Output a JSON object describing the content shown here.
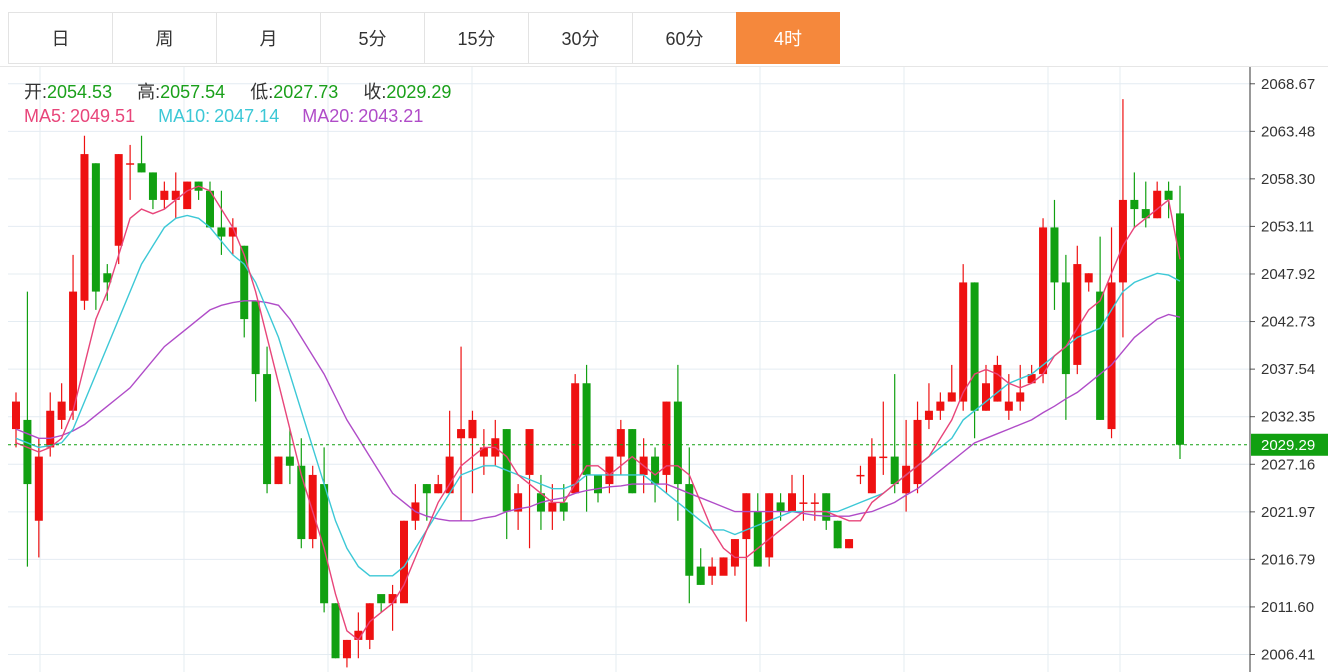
{
  "tabs": [
    {
      "label": "日",
      "active": false
    },
    {
      "label": "周",
      "active": false
    },
    {
      "label": "月",
      "active": false
    },
    {
      "label": "5分",
      "active": false
    },
    {
      "label": "15分",
      "active": false
    },
    {
      "label": "30分",
      "active": false
    },
    {
      "label": "60分",
      "active": false
    },
    {
      "label": "4时",
      "active": true
    }
  ],
  "info": {
    "open_label": "开:",
    "open": "2054.53",
    "high_label": "高:",
    "high": "2057.54",
    "low_label": "低:",
    "low": "2027.73",
    "close_label": "收:",
    "close": "2029.29"
  },
  "ma": {
    "ma5_label": "MA5:",
    "ma5": "2049.51",
    "ma10_label": "MA10:",
    "ma10": "2047.14",
    "ma20_label": "MA20:",
    "ma20": "2043.21"
  },
  "colors": {
    "up": "#ee1111",
    "down": "#11a011",
    "ma5": "#e8457a",
    "ma10": "#3cc8d6",
    "ma20": "#b04cc8",
    "accent": "#f5883c",
    "last_price": "#11a011"
  },
  "chart_data": {
    "type": "candlestick",
    "y_axis_ticks": [
      "2068.67",
      "2063.48",
      "2058.30",
      "2053.11",
      "2047.92",
      "2042.73",
      "2037.54",
      "2032.35",
      "2027.16",
      "2021.97",
      "2016.79",
      "2011.60",
      "2006.41"
    ],
    "ylim": [
      2004.5,
      2070.5
    ],
    "last_price": "2029.29",
    "grid": true,
    "candles": [
      [
        2031,
        2034,
        2029,
        2035
      ],
      [
        2032,
        2025,
        2016,
        2046
      ],
      [
        2021,
        2028,
        2017,
        2030
      ],
      [
        2029,
        2033,
        2028,
        2035
      ],
      [
        2032,
        2034,
        2031,
        2036
      ],
      [
        2033,
        2046,
        2032,
        2050
      ],
      [
        2045,
        2061,
        2044,
        2063
      ],
      [
        2060,
        2046,
        2044,
        2060
      ],
      [
        2048,
        2047,
        2045,
        2049
      ],
      [
        2051,
        2061,
        2049,
        2061
      ],
      [
        2060,
        2060,
        2056,
        2062
      ],
      [
        2060,
        2059,
        2059,
        2063
      ],
      [
        2059,
        2056,
        2055,
        2059
      ],
      [
        2056,
        2057,
        2055,
        2058
      ],
      [
        2056,
        2057,
        2054,
        2059
      ],
      [
        2055,
        2058,
        2055,
        2058
      ],
      [
        2058,
        2057,
        2056,
        2058
      ],
      [
        2057,
        2053,
        2053,
        2058
      ],
      [
        2053,
        2052,
        2050,
        2057
      ],
      [
        2052,
        2053,
        2050,
        2054
      ],
      [
        2051,
        2043,
        2041,
        2051
      ],
      [
        2045,
        2037,
        2034,
        2045
      ],
      [
        2037,
        2025,
        2024,
        2040
      ],
      [
        2025,
        2028,
        2025,
        2028
      ],
      [
        2028,
        2027,
        2025,
        2031
      ],
      [
        2027,
        2019,
        2018,
        2030
      ],
      [
        2019,
        2026,
        2018,
        2027
      ],
      [
        2025,
        2012,
        2011,
        2029
      ],
      [
        2012,
        2006,
        2006,
        2012
      ],
      [
        2006,
        2008,
        2005,
        2008
      ],
      [
        2008,
        2009,
        2006,
        2011
      ],
      [
        2008,
        2012,
        2007,
        2012
      ],
      [
        2013,
        2012,
        2011,
        2012
      ],
      [
        2012,
        2013,
        2009,
        2014
      ],
      [
        2012,
        2021,
        2013,
        2021
      ],
      [
        2021,
        2023,
        2020,
        2025
      ],
      [
        2025,
        2024,
        2021,
        2025
      ],
      [
        2024,
        2025,
        2024,
        2026
      ],
      [
        2024,
        2028,
        2024,
        2033
      ],
      [
        2030,
        2031,
        2021,
        2040
      ],
      [
        2030,
        2032,
        2024,
        2033
      ],
      [
        2028,
        2029,
        2026,
        2031
      ],
      [
        2028,
        2030,
        2027,
        2032
      ],
      [
        2031,
        2022,
        2019,
        2031
      ],
      [
        2022,
        2024,
        2020,
        2025
      ],
      [
        2026,
        2031,
        2018,
        2026
      ],
      [
        2024,
        2022,
        2020,
        2026
      ],
      [
        2022,
        2023,
        2020,
        2025
      ],
      [
        2023,
        2022,
        2021,
        2025
      ],
      [
        2024,
        2036,
        2024,
        2037
      ],
      [
        2036,
        2026,
        2022,
        2038
      ],
      [
        2026,
        2024,
        2023,
        2026
      ],
      [
        2025,
        2028,
        2024,
        2028
      ],
      [
        2028,
        2031,
        2026,
        2032
      ],
      [
        2031,
        2024,
        2024,
        2031
      ],
      [
        2026,
        2028,
        2024,
        2030
      ],
      [
        2028,
        2025,
        2023,
        2029
      ],
      [
        2026,
        2034,
        2024,
        2034
      ],
      [
        2034,
        2025,
        2021,
        2038
      ],
      [
        2025,
        2015,
        2012,
        2029
      ],
      [
        2016,
        2014,
        2014,
        2018
      ],
      [
        2015,
        2016,
        2014,
        2017
      ],
      [
        2015,
        2017,
        2016,
        2017
      ],
      [
        2016,
        2019,
        2015,
        2019
      ],
      [
        2019,
        2024,
        2010,
        2024
      ],
      [
        2022,
        2016,
        2016,
        2024
      ],
      [
        2017,
        2024,
        2016,
        2024
      ],
      [
        2023,
        2022,
        2021,
        2024
      ],
      [
        2022,
        2024,
        2022,
        2026
      ],
      [
        2023,
        2023,
        2021,
        2026
      ],
      [
        2023,
        2023,
        2021,
        2024
      ],
      [
        2024,
        2021,
        2020,
        2024
      ],
      [
        2021,
        2018,
        2018,
        2021
      ],
      [
        2018,
        2019,
        2018,
        2019
      ],
      [
        2026,
        2026,
        2025,
        2027
      ],
      [
        2024,
        2028,
        2024,
        2030
      ],
      [
        2028,
        2028,
        2026,
        2034
      ],
      [
        2028,
        2025,
        2024,
        2037
      ],
      [
        2024,
        2027,
        2022,
        2032
      ],
      [
        2025,
        2032,
        2024,
        2034
      ],
      [
        2032,
        2033,
        2031,
        2036
      ],
      [
        2033,
        2034,
        2032,
        2035
      ],
      [
        2034,
        2035,
        2034,
        2038
      ],
      [
        2034,
        2047,
        2033,
        2049
      ],
      [
        2047,
        2033,
        2030,
        2047
      ],
      [
        2033,
        2036,
        2033,
        2038
      ],
      [
        2034,
        2038,
        2034,
        2039
      ],
      [
        2033,
        2034,
        2032,
        2037
      ],
      [
        2034,
        2035,
        2033,
        2038
      ],
      [
        2036,
        2037,
        2036,
        2038
      ],
      [
        2037,
        2053,
        2036,
        2054
      ],
      [
        2053,
        2047,
        2044,
        2056
      ],
      [
        2047,
        2037,
        2032,
        2050
      ],
      [
        2038,
        2049,
        2037,
        2051
      ],
      [
        2047,
        2048,
        2046,
        2048
      ],
      [
        2046,
        2032,
        2032,
        2052
      ],
      [
        2031,
        2047,
        2030,
        2053
      ],
      [
        2047,
        2056,
        2041,
        2067
      ],
      [
        2056,
        2055,
        2053,
        2059
      ],
      [
        2055,
        2054,
        2053,
        2058
      ],
      [
        2054,
        2057,
        2054,
        2058
      ],
      [
        2057,
        2056,
        2054,
        2058
      ],
      [
        2054.53,
        2029.29,
        2027.73,
        2057.54
      ]
    ],
    "ma5": [
      2029.5,
      2029,
      2028.5,
      2029,
      2030,
      2033,
      2038,
      2043,
      2046,
      2050,
      2054,
      2055,
      2054.5,
      2055,
      2056,
      2057,
      2057.5,
      2057,
      2055,
      2053,
      2050,
      2046,
      2041,
      2036,
      2031,
      2026,
      2022,
      2018,
      2013,
      2009,
      2008,
      2010,
      2011,
      2012,
      2014,
      2017,
      2020,
      2023,
      2025,
      2027,
      2028,
      2029,
      2029,
      2028,
      2026,
      2025,
      2024,
      2023,
      2023,
      2025,
      2027,
      2027,
      2026,
      2027,
      2028,
      2027,
      2026,
      2027,
      2027,
      2026,
      2023,
      2020,
      2018,
      2017,
      2017,
      2018,
      2019,
      2020,
      2021,
      2022,
      2022,
      2022,
      2021.5,
      2021,
      2021,
      2023,
      2024,
      2025,
      2026,
      2027,
      2028,
      2030,
      2032,
      2035,
      2037,
      2037.5,
      2037,
      2036,
      2035.5,
      2036,
      2037,
      2039,
      2040,
      2042,
      2044,
      2045,
      2048,
      2051,
      2053,
      2054,
      2055,
      2056,
      2049.51
    ],
    "ma10": [
      2030,
      2029.5,
      2029,
      2029.2,
      2029.5,
      2031,
      2034,
      2037,
      2040,
      2043,
      2046,
      2049,
      2051,
      2053,
      2054,
      2054.3,
      2054,
      2053,
      2051.5,
      2050,
      2049,
      2047,
      2044,
      2041,
      2037,
      2033,
      2029,
      2025,
      2021,
      2018,
      2016,
      2015,
      2015,
      2015,
      2016,
      2018,
      2020,
      2022,
      2024,
      2026,
      2026.5,
      2027,
      2027,
      2026.5,
      2026,
      2025.5,
      2025,
      2024.5,
      2024.5,
      2025,
      2026,
      2026,
      2026,
      2026,
      2026,
      2026,
      2025,
      2024,
      2023,
      2022,
      2021,
      2020,
      2020,
      2019.5,
      2020,
      2020.5,
      2021,
      2021.5,
      2022,
      2022,
      2022,
      2022,
      2022,
      2022.5,
      2023,
      2023.5,
      2024,
      2025,
      2026,
      2027,
      2028,
      2029,
      2030,
      2032,
      2033,
      2034,
      2035,
      2036,
      2036.5,
      2037,
      2038,
      2039,
      2040,
      2041,
      2041.5,
      2042,
      2044,
      2046,
      2047,
      2047.5,
      2048,
      2047.8,
      2047.14
    ],
    "ma20": [
      2031,
      2030.5,
      2030,
      2030,
      2030.3,
      2030.8,
      2031.5,
      2032.5,
      2033.5,
      2034.5,
      2035.5,
      2037,
      2038.5,
      2040,
      2041,
      2042,
      2043,
      2044,
      2044.5,
      2044.8,
      2045,
      2045,
      2044.8,
      2044.5,
      2043,
      2041,
      2039,
      2037,
      2034.5,
      2032,
      2030,
      2028,
      2026,
      2024,
      2023,
      2022,
      2021.5,
      2021.2,
      2021,
      2021,
      2021,
      2021.3,
      2021.5,
      2022,
      2022.3,
      2022.5,
      2023,
      2023.3,
      2023.5,
      2024,
      2024.3,
      2024.5,
      2024.7,
      2024.8,
      2025,
      2025,
      2025,
      2025,
      2024.5,
      2024,
      2023.5,
      2023,
      2022.5,
      2022,
      2022,
      2022,
      2022,
      2022,
      2022,
      2021.8,
      2021.6,
      2021.5,
      2021.5,
      2021.5,
      2021.8,
      2022,
      2022.5,
      2023,
      2023.8,
      2024.5,
      2025.5,
      2026.5,
      2027.5,
      2028.5,
      2029.5,
      2030,
      2030.5,
      2031,
      2031.5,
      2032,
      2032.8,
      2033.5,
      2034.3,
      2035,
      2036,
      2037,
      2038,
      2039.5,
      2041,
      2042,
      2043,
      2043.5,
      2043.21
    ]
  }
}
